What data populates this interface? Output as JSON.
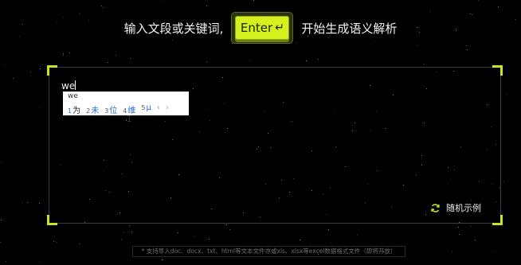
{
  "header": {
    "prompt_before": "输入文段或关键词,",
    "enter_key_label": "Enter",
    "enter_key_icon": "return-icon",
    "prompt_after": "开始生成语义解析"
  },
  "editor": {
    "typed_text": "we",
    "ime": {
      "pinyin": "we",
      "candidates": [
        {
          "num": "1",
          "text": "为"
        },
        {
          "num": "2",
          "text": "未"
        },
        {
          "num": "3",
          "text": "位"
        },
        {
          "num": "4",
          "text": "维"
        },
        {
          "num": "5",
          "text": "μ"
        }
      ],
      "nav_prev": "‹",
      "nav_next": "›"
    },
    "random_example_label": "随机示例",
    "random_example_icon": "refresh-icon"
  },
  "footer": {
    "note": "* 支持导入doc、docx、txt、html等文本文件亦或xls、xlsx等excel数据格式文件（即将开放）"
  },
  "colors": {
    "accent": "#d4f01e",
    "background": "#000000",
    "ime_highlight": "#2b6fd8"
  }
}
